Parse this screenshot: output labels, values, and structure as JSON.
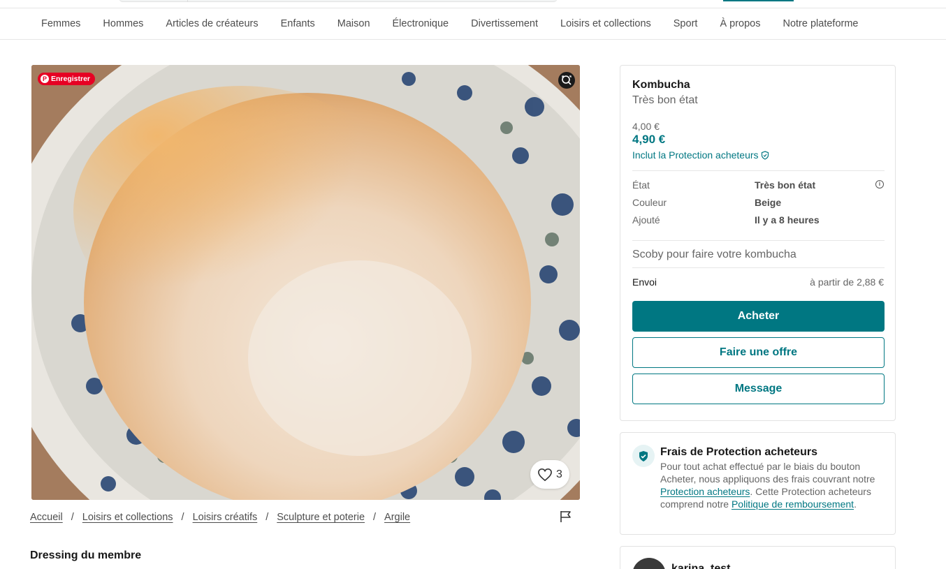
{
  "nav": {
    "categories": [
      "Femmes",
      "Hommes",
      "Articles de créateurs",
      "Enfants",
      "Maison",
      "Électronique",
      "Divertissement",
      "Loisirs et collections",
      "Sport",
      "À propos",
      "Notre plateforme"
    ]
  },
  "photo": {
    "pinterest_label": "Enregistrer",
    "favourites_count": "3"
  },
  "breadcrumb": {
    "items": [
      "Accueil",
      "Loisirs et collections",
      "Loisirs créatifs",
      "Sculpture et poterie",
      "Argile"
    ],
    "separator": "/"
  },
  "member_section_title": "Dressing du membre",
  "item": {
    "title": "Kombucha",
    "condition_subtitle": "Très bon état",
    "price_original": "4,00 €",
    "price_total": "4,90 €",
    "protection_note": "Inclut la Protection acheteurs",
    "details": [
      {
        "label": "État",
        "value": "Très bon état"
      },
      {
        "label": "Couleur",
        "value": "Beige"
      },
      {
        "label": "Ajouté",
        "value": "Il y a 8 heures"
      }
    ],
    "description": "Scoby pour faire votre kombucha",
    "shipping_label": "Envoi",
    "shipping_value": "à partir de 2,88 €",
    "buy_label": "Acheter",
    "offer_label": "Faire une offre",
    "message_label": "Message"
  },
  "protection_card": {
    "title": "Frais de Protection acheteurs",
    "text_1": "Pour tout achat effectué par le biais du bouton Acheter, nous appliquons des frais couvrant notre ",
    "link_1": "Protection acheteurs",
    "text_2": ". Cette Protection acheteurs comprend notre ",
    "link_2": "Politique de remboursement",
    "text_3": "."
  },
  "seller": {
    "username": "karina_test"
  },
  "colors": {
    "accent": "#007782",
    "pinterest": "#e60023",
    "muted_text": "#666666"
  }
}
